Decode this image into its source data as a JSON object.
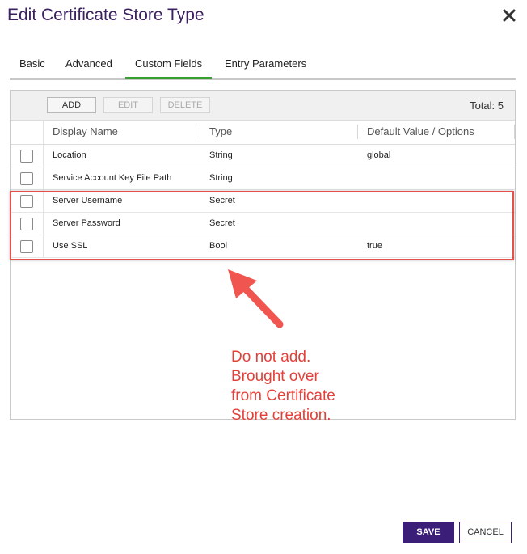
{
  "dialog": {
    "title": "Edit Certificate Store Type"
  },
  "tabs": [
    {
      "label": "Basic"
    },
    {
      "label": "Advanced"
    },
    {
      "label": "Custom Fields",
      "active": true
    },
    {
      "label": "Entry Parameters"
    }
  ],
  "toolbar": {
    "add_label": "ADD",
    "edit_label": "EDIT",
    "delete_label": "DELETE",
    "total_label": "Total: 5"
  },
  "table": {
    "columns": [
      "Display Name",
      "Type",
      "Default Value / Options"
    ],
    "rows": [
      {
        "name": "Location",
        "type": "String",
        "default": "global"
      },
      {
        "name": "Service Account Key File Path",
        "type": "String",
        "default": ""
      },
      {
        "name": "Server Username",
        "type": "Secret",
        "default": ""
      },
      {
        "name": "Server Password",
        "type": "Secret",
        "default": ""
      },
      {
        "name": "Use SSL",
        "type": "Bool",
        "default": "true"
      }
    ]
  },
  "annotation": {
    "lines": [
      "Do not add.",
      "Brought over",
      "from Certificate",
      "Store creation."
    ]
  },
  "footer": {
    "save_label": "SAVE",
    "cancel_label": "CANCEL"
  },
  "colors": {
    "title": "#3b2062",
    "active_tab_underline": "#35a02b",
    "primary_button": "#3b1e78",
    "annotation_red": "#e4403a"
  },
  "icons": {
    "close": "close-icon",
    "arrow": "annotation-arrow"
  }
}
